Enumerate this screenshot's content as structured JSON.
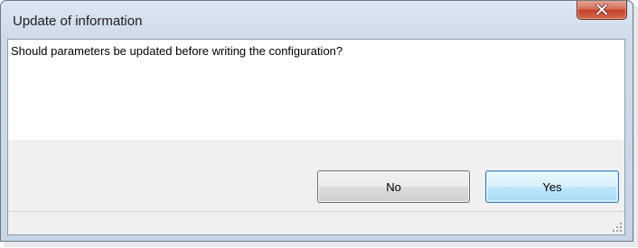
{
  "window": {
    "title": "Update of information",
    "close_icon": "close-icon",
    "accent_close": "#c4422c"
  },
  "dialog": {
    "message": "Should parameters be updated before writing the configuration?",
    "buttons": {
      "no_label": "No",
      "yes_label": "Yes"
    }
  },
  "statusbar": {
    "grip_icon": "resize-grip-icon"
  }
}
